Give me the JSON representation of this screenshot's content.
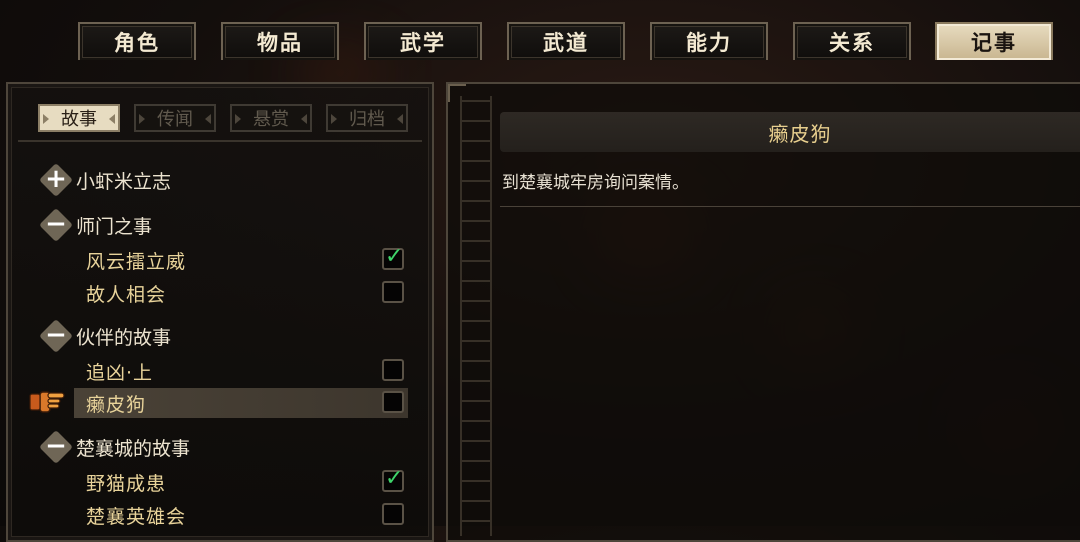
{
  "top_tabs": [
    {
      "label": "角色",
      "active": false
    },
    {
      "label": "物品",
      "active": false
    },
    {
      "label": "武学",
      "active": false
    },
    {
      "label": "武道",
      "active": false
    },
    {
      "label": "能力",
      "active": false
    },
    {
      "label": "关系",
      "active": false
    },
    {
      "label": "记事",
      "active": true
    }
  ],
  "sub_tabs": [
    {
      "label": "故事",
      "active": true
    },
    {
      "label": "传闻",
      "active": false
    },
    {
      "label": "悬赏",
      "active": false
    },
    {
      "label": "归档",
      "active": false
    }
  ],
  "tree": {
    "groups": [
      {
        "label": "小虾米立志",
        "expanded": false,
        "icon": "plus-icon"
      },
      {
        "label": "师门之事",
        "expanded": true,
        "icon": "minus-icon"
      },
      {
        "label": "伙伴的故事",
        "expanded": true,
        "icon": "minus-icon"
      },
      {
        "label": "楚襄城的故事",
        "expanded": true,
        "icon": "minus-icon"
      }
    ],
    "quests": [
      {
        "label": "风云擂立威",
        "completed": true
      },
      {
        "label": "故人相会",
        "completed": false
      },
      {
        "label": "追凶·上",
        "completed": false
      },
      {
        "label": "癞皮狗",
        "completed": false,
        "selected": true
      },
      {
        "label": "野猫成患",
        "completed": true
      },
      {
        "label": "楚襄英雄会",
        "completed": false
      }
    ],
    "symbols": {
      "plus": "+",
      "minus": "−",
      "check": "✓"
    }
  },
  "detail": {
    "title": "癞皮狗",
    "description": "到楚襄城牢房询问案情。"
  },
  "colors": {
    "accent_gold": "#e8cf8e",
    "check_green": "#3ed46a",
    "active_tab_bg": "#e7dcc1"
  }
}
